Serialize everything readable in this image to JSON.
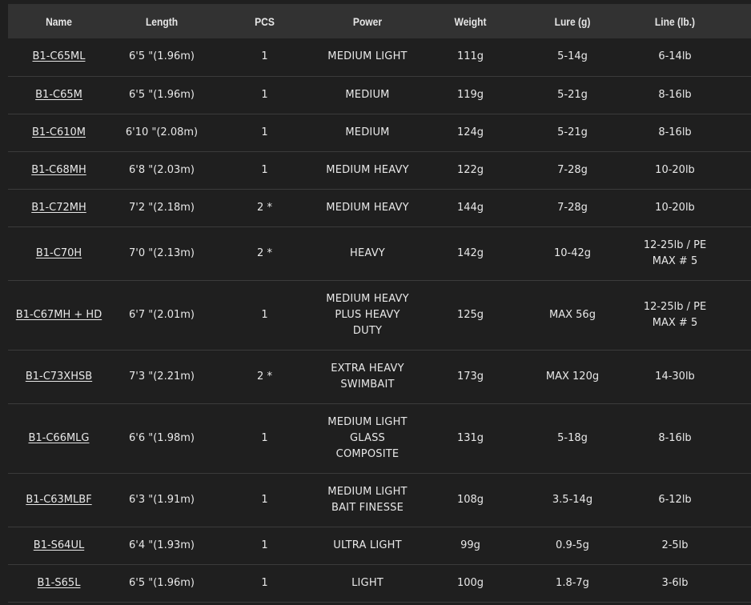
{
  "table": {
    "headers": {
      "name": "Name",
      "length": "Length",
      "pcs": "PCS",
      "power": "Power",
      "weight": "Weight",
      "lure": "Lure (g)",
      "line": "Line (lb.)"
    },
    "rows": [
      {
        "name": "B1-C65ML",
        "length": "6'5 \"(1.96m)",
        "pcs": "1",
        "power": [
          "MEDIUM LIGHT"
        ],
        "weight": "111g",
        "lure": "5-14g",
        "line": [
          "6-14lb"
        ]
      },
      {
        "name": "B1-C65M",
        "length": "6'5 \"(1.96m)",
        "pcs": "1",
        "power": [
          "MEDIUM"
        ],
        "weight": "119g",
        "lure": "5-21g",
        "line": [
          "8-16lb"
        ]
      },
      {
        "name": "B1-C610M",
        "length": "6'10 \"(2.08m)",
        "pcs": "1",
        "power": [
          "MEDIUM"
        ],
        "weight": "124g",
        "lure": "5-21g",
        "line": [
          "8-16lb"
        ]
      },
      {
        "name": "B1-C68MH",
        "length": "6'8 \"(2.03m)",
        "pcs": "1",
        "power": [
          "MEDIUM HEAVY"
        ],
        "weight": "122g",
        "lure": "7-28g",
        "line": [
          "10-20lb"
        ]
      },
      {
        "name": "B1-C72MH",
        "length": "7'2 \"(2.18m)",
        "pcs": "2 *",
        "power": [
          "MEDIUM HEAVY"
        ],
        "weight": "144g",
        "lure": "7-28g",
        "line": [
          "10-20lb"
        ]
      },
      {
        "name": "B1-C70H",
        "length": "7'0 \"(2.13m)",
        "pcs": "2 *",
        "power": [
          "HEAVY"
        ],
        "weight": "142g",
        "lure": "10-42g",
        "line": [
          "12-25lb / PE",
          "MAX # 5"
        ]
      },
      {
        "name": "B1-C67MH + HD",
        "length": "6'7 \"(2.01m)",
        "pcs": "1",
        "power": [
          "MEDIUM HEAVY",
          "PLUS HEAVY",
          "DUTY"
        ],
        "weight": "125g",
        "lure": "MAX 56g",
        "line": [
          "12-25lb / PE",
          "MAX # 5"
        ]
      },
      {
        "name": "B1-C73XHSB",
        "length": "7'3 \"(2.21m)",
        "pcs": "2 *",
        "power": [
          "EXTRA HEAVY",
          "SWIMBAIT"
        ],
        "weight": "173g",
        "lure": "MAX 120g",
        "line": [
          "14-30lb"
        ]
      },
      {
        "name": "B1-C66MLG",
        "length": "6'6 \"(1.98m)",
        "pcs": "1",
        "power": [
          "MEDIUM LIGHT",
          "GLASS",
          "COMPOSITE"
        ],
        "weight": "131g",
        "lure": "5-18g",
        "line": [
          "8-16lb"
        ]
      },
      {
        "name": "B1-C63MLBF",
        "length": "6'3 \"(1.91m)",
        "pcs": "1",
        "power": [
          "MEDIUM LIGHT",
          "BAIT FINESSE"
        ],
        "weight": "108g",
        "lure": "3.5-14g",
        "line": [
          "6-12lb"
        ]
      },
      {
        "name": "B1-S64UL",
        "length": "6'4 \"(1.93m)",
        "pcs": "1",
        "power": [
          "ULTRA LIGHT"
        ],
        "weight": "99g",
        "lure": "0.9-5g",
        "line": [
          "2-5lb"
        ]
      },
      {
        "name": "B1-S65L",
        "length": "6'5 \"(1.96m)",
        "pcs": "1",
        "power": [
          "LIGHT"
        ],
        "weight": "100g",
        "lure": "1.8-7g",
        "line": [
          "3-6lb"
        ]
      }
    ]
  }
}
